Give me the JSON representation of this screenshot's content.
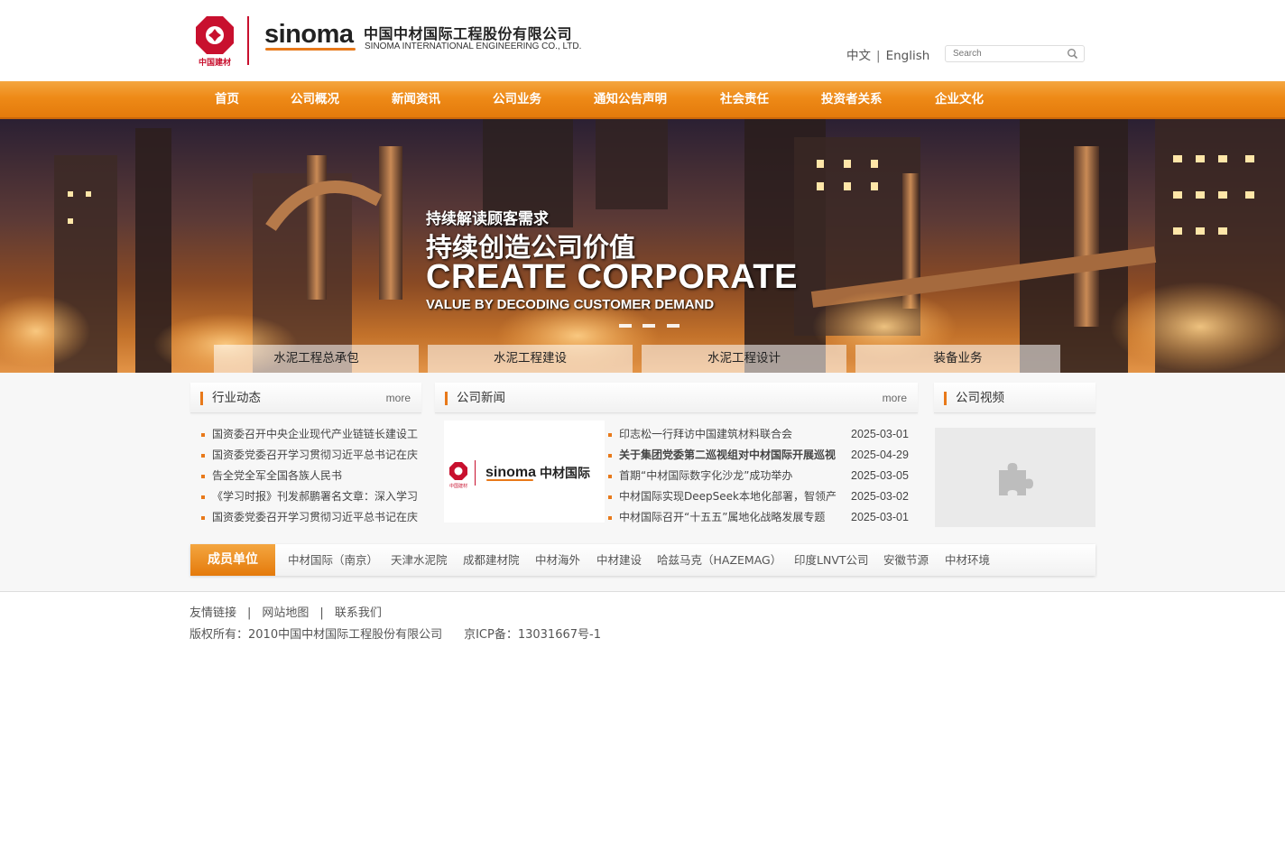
{
  "header": {
    "logo_cnbm_text": "中国建材",
    "logo_sinoma_text": "sinoma",
    "company_cn": "中国中材国际工程股份有限公司",
    "company_en": "SINOMA INTERNATIONAL ENGINEERING CO., LTD.",
    "lang_cn": "中文",
    "lang_sep": "|",
    "lang_en": "English",
    "search_placeholder": "Search"
  },
  "nav": {
    "items": [
      "首页",
      "公司概况",
      "新闻资讯",
      "公司业务",
      "通知公告声明",
      "社会责任",
      "投资者关系",
      "企业文化"
    ]
  },
  "banner": {
    "line1": "持续解读顾客需求",
    "line2": "持续创造公司价值",
    "line3": "CREATE CORPORATE",
    "line4": "VALUE BY DECODING CUSTOMER DEMAND",
    "dot_count": 3,
    "business_tabs": [
      "水泥工程总承包",
      "水泥工程建设",
      "水泥工程设计",
      "装备业务"
    ]
  },
  "industry": {
    "title": "行业动态",
    "more": "more",
    "items": [
      "国资委召开中央企业现代产业链链长建设工",
      "国资委党委召开学习贯彻习近平总书记在庆",
      "告全党全军全国各族人民书",
      "《学习时报》刊发郝鹏署名文章：深入学习",
      "国资委党委召开学习贯彻习近平总书记在庆"
    ]
  },
  "company_news": {
    "title": "公司新闻",
    "more": "more",
    "image_brand_text": "sinoma",
    "image_cn_text": "中材国际",
    "image_cnbm_text": "中国建材",
    "items": [
      {
        "title": "印志松一行拜访中国建筑材料联合会",
        "date": "2025-03-01",
        "bold": false
      },
      {
        "title": "关于集团党委第二巡视组对中材国际开展巡视",
        "date": "2025-04-29",
        "bold": true
      },
      {
        "title": "首期“中材国际数字化沙龙”成功举办",
        "date": "2025-03-05",
        "bold": false
      },
      {
        "title": "中材国际实现DeepSeek本地化部署，智领产",
        "date": "2025-03-02",
        "bold": false
      },
      {
        "title": "中材国际召开“十五五”属地化战略发展专题",
        "date": "2025-03-01",
        "bold": false
      }
    ]
  },
  "video": {
    "title": "公司视频"
  },
  "members": {
    "label": "成员单位",
    "items": [
      "中材国际（南京）",
      "天津水泥院",
      "成都建材院",
      "中材海外",
      "中材建设",
      "哈兹马克（HAZEMAG）",
      "印度LNVT公司",
      "安徽节源",
      "中材环境"
    ]
  },
  "footer": {
    "links": [
      "友情链接",
      "网站地图",
      "联系我们"
    ],
    "link_sep": "|",
    "copyright": "版权所有：2010中国中材国际工程股份有限公司",
    "icp": "京ICP备：13031667号-1"
  },
  "colors": {
    "accent_orange": "#ee8a17",
    "brand_red": "#c8102e"
  }
}
